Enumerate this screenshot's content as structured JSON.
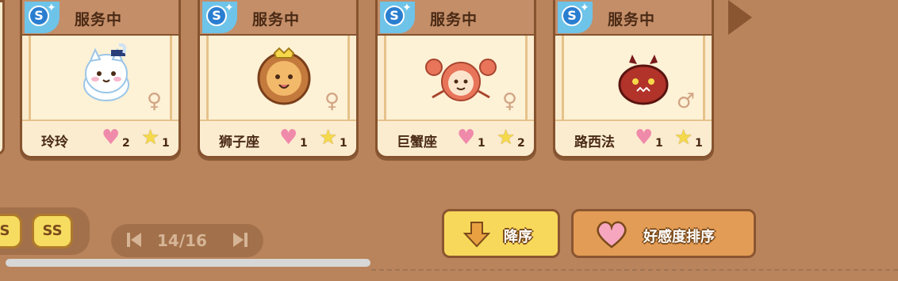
{
  "cards": [
    {
      "status": "服务中",
      "name": "玲玲",
      "hearts": "2",
      "stars": "1",
      "gender": "♀"
    },
    {
      "status": "服务中",
      "name": "狮子座",
      "hearts": "1",
      "stars": "1",
      "gender": "♀"
    },
    {
      "status": "服务中",
      "name": "巨蟹座",
      "hearts": "1",
      "stars": "2",
      "gender": "♀"
    },
    {
      "status": "服务中",
      "name": "路西法",
      "hearts": "1",
      "stars": "1",
      "gender": "♂"
    }
  ],
  "filters": {
    "s": "S",
    "ss": "SS"
  },
  "pager": {
    "page": "14/16"
  },
  "buttons": {
    "descending": "降序",
    "favor_sort": "好感度排序"
  },
  "icons": {
    "rank_badge": "S"
  }
}
